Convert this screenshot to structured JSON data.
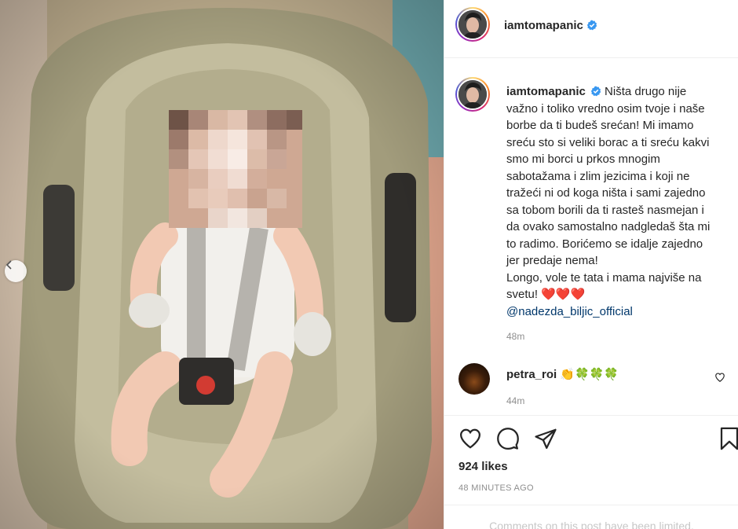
{
  "post": {
    "author": "iamtomapanic",
    "verified": true,
    "caption_lines": [
      "Ništa drugo nije",
      "važno i toliko vredno osim tvoje i naše",
      "borbe da ti budeš srećan! Mi imamo",
      "sreću sto si veliki borac a ti sreću kakvi",
      "smo mi borci u prkos mnogim",
      "sabotažama i zlim jezicima i koji ne",
      "tražeći ni od koga ništa i sami zajedno",
      "sa tobom borili da ti rasteš nasmejan i",
      "da ovako samostalno nadgledaš šta mi",
      "to radimo. Borićemo se idalje zajedno",
      "jer predaje nema!",
      "Longo, vole te tata i mama najviše na",
      "svetu!"
    ],
    "caption_hearts": "❤️❤️❤️",
    "mention": "@nadezda_biljic_official",
    "caption_time": "48m",
    "likes": "924 likes",
    "post_time": "48 MINUTES AGO",
    "limited_notice": "Comments on this post have been limited."
  },
  "comment": {
    "user": "petra_roi",
    "emojis": "👏🍀🍀🍀",
    "time": "44m"
  },
  "colors": {
    "verified_blue": "#3897f0",
    "heart_red": "#ed4956",
    "mention_blue": "#00376b",
    "muted_gray": "#8e8e8e"
  },
  "icons": [
    "verified-icon",
    "chevron-left-icon",
    "heart-outline-icon",
    "comment-icon",
    "share-icon",
    "bookmark-icon"
  ]
}
